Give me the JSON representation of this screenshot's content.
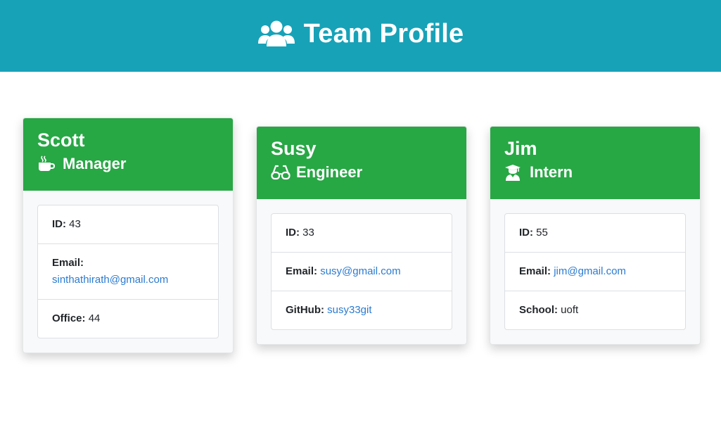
{
  "header": {
    "title": "Team Profile",
    "icon": "users-icon",
    "bg_color": "#17a2b8"
  },
  "accent": "#28a745",
  "link_color": "#2b7bd0",
  "team": [
    {
      "name": "Scott",
      "role": "Manager",
      "role_icon": "coffee-icon",
      "id_label": "ID:",
      "id": "43",
      "email_label": "Email:",
      "email": "sinthathirath@gmail.com",
      "extra_label": "Office:",
      "extra": "44"
    },
    {
      "name": "Susy",
      "role": "Engineer",
      "role_icon": "glasses-icon",
      "id_label": "ID:",
      "id": "33",
      "email_label": "Email:",
      "email": "susy@gmail.com",
      "extra_label": "GitHub:",
      "extra": "susy33git"
    },
    {
      "name": "Jim",
      "role": "Intern",
      "role_icon": "graduate-icon",
      "id_label": "ID:",
      "id": "55",
      "email_label": "Email:",
      "email": "jim@gmail.com",
      "extra_label": "School:",
      "extra": "uoft"
    }
  ]
}
